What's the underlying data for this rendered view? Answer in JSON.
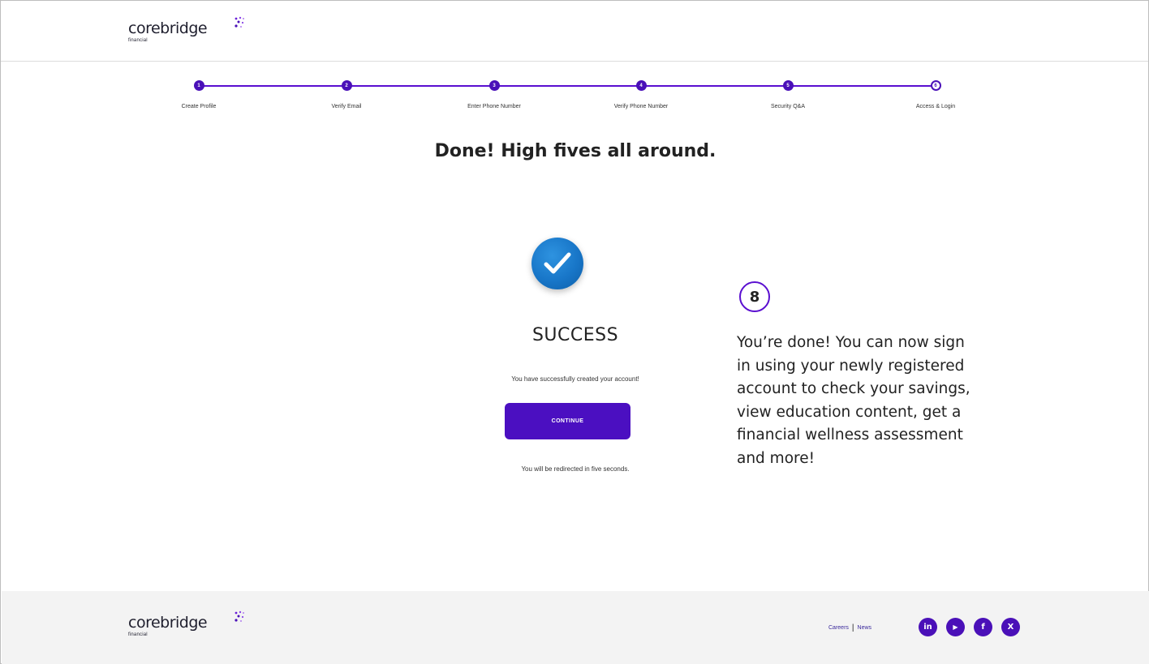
{
  "brand": {
    "name": "corebridge",
    "sub": "financial"
  },
  "stepper": {
    "steps": [
      {
        "num": "1",
        "label": "Create Profile"
      },
      {
        "num": "2",
        "label": "Verify Email"
      },
      {
        "num": "3",
        "label": "Enter Phone Number"
      },
      {
        "num": "4",
        "label": "Verify Phone Number"
      },
      {
        "num": "5",
        "label": "Security Q&A"
      },
      {
        "num": "6",
        "label": "Access & Login"
      }
    ]
  },
  "main": {
    "headline": "Done! High fives all around.",
    "success_title": "SUCCESS",
    "success_message": "You have successfully created your account!",
    "continue_label": "CONTINUE",
    "redirect_message": "You will be redirected in five seconds."
  },
  "annotation": {
    "step": "8",
    "text": "You’re done! You can now sign in using your newly registered account to check your savings, view education content, get a financial wellness assessment and more!"
  },
  "footer": {
    "links": [
      "Careers",
      "News"
    ],
    "separator": "|",
    "social": [
      {
        "icon": "linkedin-icon",
        "glyph": "in"
      },
      {
        "icon": "youtube-icon",
        "glyph": "▶"
      },
      {
        "icon": "facebook-icon",
        "glyph": "f"
      },
      {
        "icon": "x-icon",
        "glyph": "X"
      }
    ]
  },
  "colors": {
    "accent": "#4b0fc1",
    "check_blue": "#1876c8",
    "footer_bg": "#f3f3f3"
  }
}
